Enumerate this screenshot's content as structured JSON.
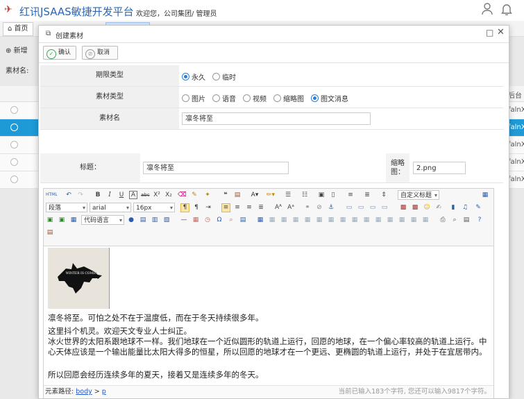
{
  "app": {
    "brand": "红讯JSAAS敏捷开发平台",
    "welcome": "欢迎您，公司集团/ 管理员",
    "home_tab": "首页",
    "add_label": "新增",
    "name_label": "素材名:",
    "right_col_header": "后台推",
    "right_col_values": [
      "falnX",
      "falnX",
      "falnX",
      "falnX",
      "falnX"
    ]
  },
  "modal": {
    "title": "创建素材",
    "confirm": "确认",
    "cancel": "取消"
  },
  "form": {
    "period_label": "期限类型",
    "period_options": [
      "永久",
      "临时"
    ],
    "period_selected": "永久",
    "type_label": "素材类型",
    "type_options": [
      "图片",
      "语音",
      "视频",
      "缩略图",
      "图文消息"
    ],
    "type_selected": "图文消息",
    "name_label": "素材名",
    "name_value": "凛冬将至",
    "title_label": "标题：",
    "title_value": "凛冬将至",
    "thumb_label_1": "缩略",
    "thumb_label_2": "图：",
    "thumb_value": "2.png"
  },
  "editor": {
    "paragraph_select": "段落",
    "font_select": "arial",
    "size_select": "16px",
    "custom_title": "自定义标题",
    "code_lang": "代码语言",
    "image_caption": "WINTER IS COMING",
    "content": [
      "凛冬将至。可怕之处不在于温度低，而在于冬天持续很多年。",
      "这里抖个机灵。欢迎天文专业人士纠正。",
      "冰火世界的太阳系跟地球不一样。我们地球在一个近似圆形的轨道上运行，回愿的地球，在一个偏心率较高的轨道上运行。中心天体应该是一个输出能量比太阳大得多的恒星，所以回愿的地球才在一个更远、更椭圆的轨道上运行，并处于在宜居带内。",
      "所以回愿会经历连续多年的夏天，接着又是连续多年的冬天。"
    ],
    "path_label": "元素路径:",
    "path_body": "body",
    "path_sep": ">",
    "path_p": "p",
    "char_count": "当前已输入183个字符, 您还可以输入9817个字符。"
  },
  "colors": {
    "brand": "#2c66b3",
    "selected_row": "#1e9ad6",
    "radio_on": "#2d7fd6",
    "confirm_icon": "#3aa757",
    "link": "#2255cc"
  }
}
